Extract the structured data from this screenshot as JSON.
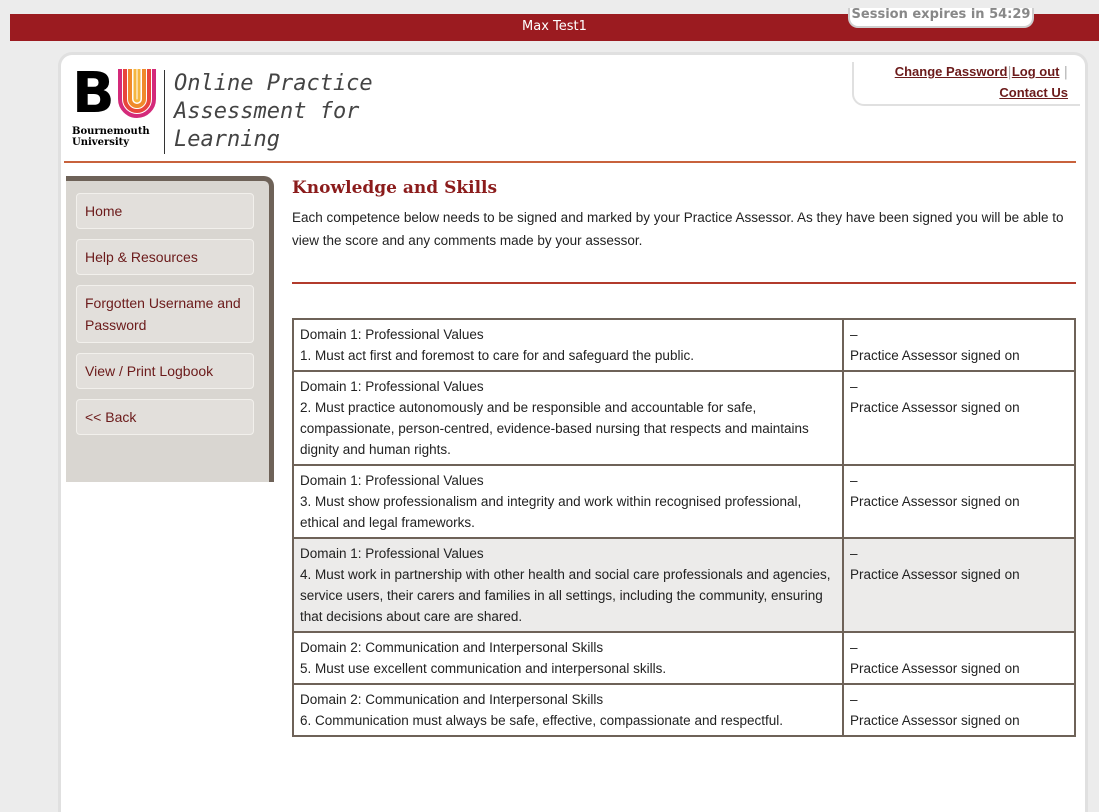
{
  "header": {
    "user": "Max Test1",
    "session": "Session expires in 54:29"
  },
  "logo": {
    "mark": "BU",
    "university": "Bournemouth University",
    "title_lines": [
      "Online Practice",
      "Assessment for",
      "Learning"
    ]
  },
  "links": {
    "change_password": "Change Password",
    "separator": "|",
    "log_out": "Log out",
    "contact_us": "Contact Us"
  },
  "sidebar": {
    "items": [
      {
        "label": "Home"
      },
      {
        "label": "Help & Resources"
      },
      {
        "label": "Forgotten Username and Password"
      },
      {
        "label": "View / Print Logbook"
      },
      {
        "label": "<< Back"
      }
    ]
  },
  "main": {
    "title": "Knowledge and Skills",
    "intro": "Each competence below needs to be signed and marked by your Practice Assessor.  As they have been signed you will be able to view the score and any comments made by your assessor.",
    "rows": [
      {
        "domain": "Domain 1: Professional Values",
        "text": "1. Must act first and foremost to care for and safeguard the public.",
        "score": "–",
        "status": "Practice Assessor signed on"
      },
      {
        "domain": "Domain 1: Professional Values",
        "text": "2. Must practice autonomously and be responsible and accountable for safe, compassionate, person-centred, evidence-based nursing that respects and maintains dignity and human rights.",
        "score": "–",
        "status": "Practice Assessor signed on"
      },
      {
        "domain": "Domain 1: Professional Values",
        "text": "3. Must show professionalism and integrity and work within recognised professional, ethical and legal frameworks.",
        "score": "–",
        "status": "Practice Assessor signed on"
      },
      {
        "domain": "Domain 1: Professional Values",
        "text": "4. Must work in partnership with other health and social care professionals and agencies, service users, their carers and families in all settings, including the community, ensuring that decisions about care are shared.",
        "score": "–",
        "status": "Practice Assessor signed on"
      },
      {
        "domain": "Domain 2: Communication and Interpersonal Skills",
        "text": "5. Must use excellent communication and interpersonal skills.",
        "score": "–",
        "status": "Practice Assessor signed on"
      },
      {
        "domain": "Domain 2: Communication and Interpersonal Skills",
        "text": "6. Communication must always be safe, effective, compassionate and respectful.",
        "score": "–",
        "status": "Practice Assessor signed on"
      }
    ]
  },
  "colors": {
    "brand_red": "#9b1b20",
    "link": "#6b1a1a",
    "accent_rule": "#c8623c",
    "sidebar_bg": "#d9d6d1"
  }
}
